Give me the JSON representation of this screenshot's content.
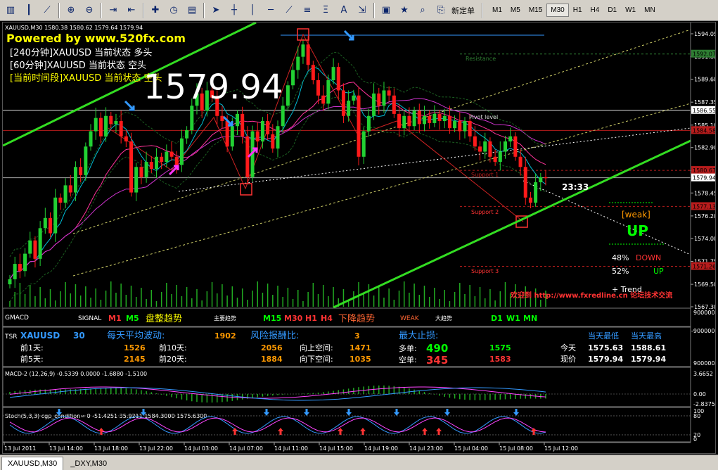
{
  "toolbar": {
    "new_order_label": "新定单",
    "timeframes": [
      "M1",
      "M5",
      "M15",
      "M30",
      "H1",
      "H4",
      "D1",
      "W1",
      "MN"
    ],
    "active_timeframe": "M30"
  },
  "chart": {
    "header": "XAUUSD,M30  1580.38 1580.62 1579.64 1579.94",
    "powered": "Powered by www.520fx.com",
    "status_240": "[240分钟]XAUUSD 当前状态 多头",
    "status_60": "[60分钟]XAUUSD 当前状态 空头",
    "status_cur": "[当前时间段]XAUUSD 当前状态 空头",
    "big_price": "1579.94",
    "countdown": "23:33",
    "resistance": "Resistance",
    "pivot": "Pivot level",
    "support1": "Support 1",
    "support2": "Support 2",
    "support3": "Support 3",
    "weak": "[weak]",
    "up_big": "UP",
    "pct_down_val": "48%",
    "pct_down_lbl": "DOWN",
    "pct_up_val": "52%",
    "pct_up_lbl": "UP",
    "trend": "+   Trend",
    "welcome": "欢迎到 http://www.fxredline.cn 论坛技术交流",
    "price_ticks": [
      "1594.05",
      "1591.80",
      "1589.60",
      "1587.35",
      "1585.10",
      "1582.90",
      "1580.65",
      "1578.45",
      "1576.20",
      "1574.00",
      "1571.75",
      "1569.50",
      "1567.30"
    ],
    "badges": [
      {
        "label": "1592.07",
        "color": "#2e7d32"
      },
      {
        "label": "1586.55",
        "color": "#ffffff"
      },
      {
        "label": "1584.58",
        "color": "#b71c1c"
      },
      {
        "label": "1580.67",
        "color": "#b71c1c"
      },
      {
        "label": "1579.94",
        "color": "#ffffff"
      },
      {
        "label": "1577.13",
        "color": "#b71c1c"
      },
      {
        "label": "1571.26",
        "color": "#b71c1c"
      }
    ]
  },
  "gmacd": {
    "name": "GMACD",
    "signal": "SIGNAL",
    "m1": "M1",
    "m5": "M5",
    "zhengli": "盘整趋势",
    "main_trend": "主要趋势",
    "m15": "M15",
    "m30": "M30",
    "h1": "H1",
    "h4": "H4",
    "down_trend": "下降趋势",
    "weak": "WEAK",
    "big_trend": "大趋势",
    "d1": "D1",
    "w1": "W1",
    "mn": "MN",
    "scale_top": "9000000",
    "scale_bottom": "-9000000"
  },
  "tsr": {
    "name": "TSR",
    "symbol": "XAUUSD",
    "period": "30",
    "avg_label": "每天平均波动:",
    "avg_value": "1902",
    "rr_label": "风险报酬比:",
    "rr_value": "3",
    "maxstop_label": "最大止损:",
    "low_label": "当天最低",
    "high_label": "当天最高",
    "prev1_label": "前1天:",
    "prev1_value": "1526",
    "prev10_label": "前10天:",
    "prev10_value": "2056",
    "up_space_label": "向上空间:",
    "up_space_value": "1471",
    "long_label": "多单:",
    "long_value": "490",
    "long_price": "1575",
    "today_label": "今天",
    "today_low": "1575.63",
    "today_high": "1588.61",
    "prev5_label": "前5天:",
    "prev5_value": "2145",
    "prev20_label": "前20天:",
    "prev20_value": "1884",
    "down_space_label": "向下空间:",
    "down_space_value": "1035",
    "short_label": "空单:",
    "short_value": "345",
    "short_price": "1583",
    "now_label": "现价",
    "now_low": "1579.94",
    "now_high": "1579.94",
    "scale_top": "9000000"
  },
  "macd": {
    "header": "MACD-2 (12,26,9) -0.5339 0.0000 -1.6880 -1.5100",
    "tick_top": "3.6652",
    "tick_zero": "0.00",
    "tick_bottom": "-2.8375"
  },
  "stoch": {
    "header": "Stoch(5,3,3) cgp_condition=  0  -51.4251 35.9211  1584.3000  1575.6300",
    "tick_top": "100",
    "tick_80": "80",
    "tick_20": "20",
    "tick_zero": "0"
  },
  "time_axis": [
    "13 Jul 2011",
    "13 Jul 14:00",
    "13 Jul 18:00",
    "13 Jul 22:00",
    "14 Jul 03:00",
    "14 Jul 07:00",
    "14 Jul 11:00",
    "14 Jul 15:00",
    "14 Jul 19:00",
    "14 Jul 23:00",
    "15 Jul 04:00",
    "15 Jul 08:00",
    "15 Jul 12:00"
  ],
  "tabs": [
    {
      "label": "XAUUSD,M30",
      "active": true
    },
    {
      "label": "_DXY,M30",
      "active": false
    }
  ],
  "colors": {
    "bull": "#22d133",
    "bear": "#ff1a1a",
    "trendline": "#33dd22",
    "accent_green": "#00ff00"
  }
}
